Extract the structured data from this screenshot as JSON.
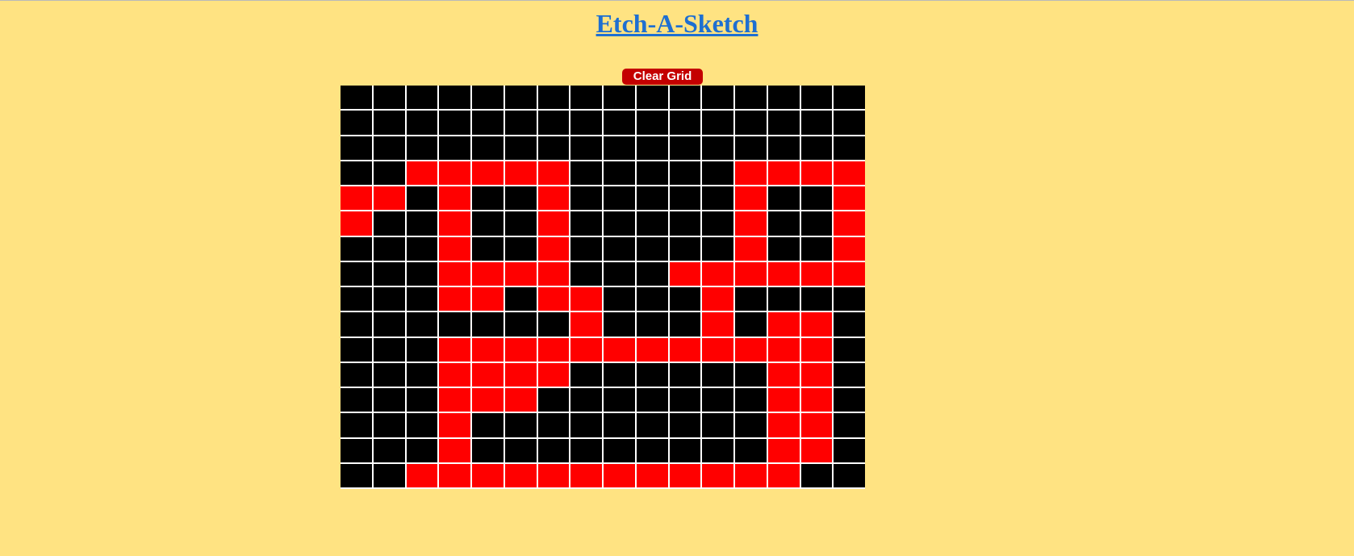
{
  "title": "Etch-A-Sketch",
  "clear_button_label": "Clear Grid",
  "grid": {
    "size": 16,
    "background_color": "#000000",
    "draw_color": "#ff0000",
    "rows": [
      "0000000000000000",
      "0000000000000000",
      "0000000000000000",
      "0011111000001111",
      "1101001000001001",
      "1001001000001001",
      "0001001000001001",
      "0001111000111111",
      "0001101100010000",
      "0000000100010110",
      "0001111111111110",
      "0001111000000110",
      "0001110000000110",
      "0001000000000110",
      "0001000000000110",
      "0011111111111100"
    ]
  },
  "colors": {
    "page_background": "#ffe382",
    "title": "#1e6fd1",
    "button": "#c40000"
  }
}
